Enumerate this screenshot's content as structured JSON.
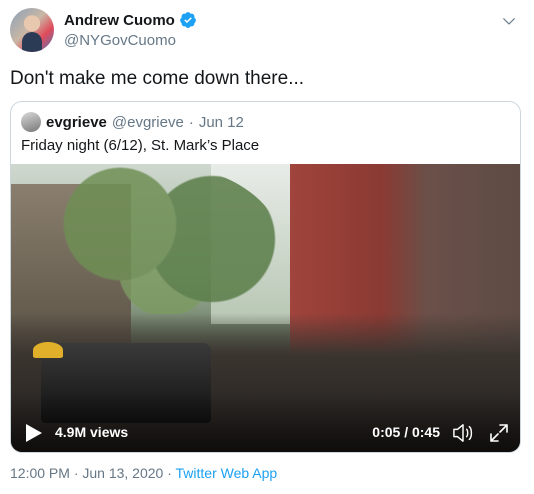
{
  "tweet": {
    "author_name": "Andrew Cuomo",
    "author_handle": "@NYGovCuomo",
    "text": "Don't make me come down there..."
  },
  "quote": {
    "author_name": "evgrieve",
    "author_handle": "@evgrieve",
    "separator": "·",
    "date": "Jun 12",
    "text": "Friday night (6/12), St. Mark’s Place"
  },
  "video": {
    "views": "4.9M views",
    "time": "0:05 / 0:45"
  },
  "meta": {
    "timestamp": "12:00 PM · Jun 13, 2020",
    "separator": "·",
    "app": "Twitter Web App"
  },
  "icons": {
    "verified": "verified-badge-icon",
    "caret": "chevron-down-icon",
    "play": "play-icon",
    "volume": "volume-icon",
    "fullscreen": "fullscreen-icon"
  },
  "colors": {
    "brand": "#1da1f2",
    "secondary_text": "#657786",
    "border": "#ccd6dd"
  }
}
